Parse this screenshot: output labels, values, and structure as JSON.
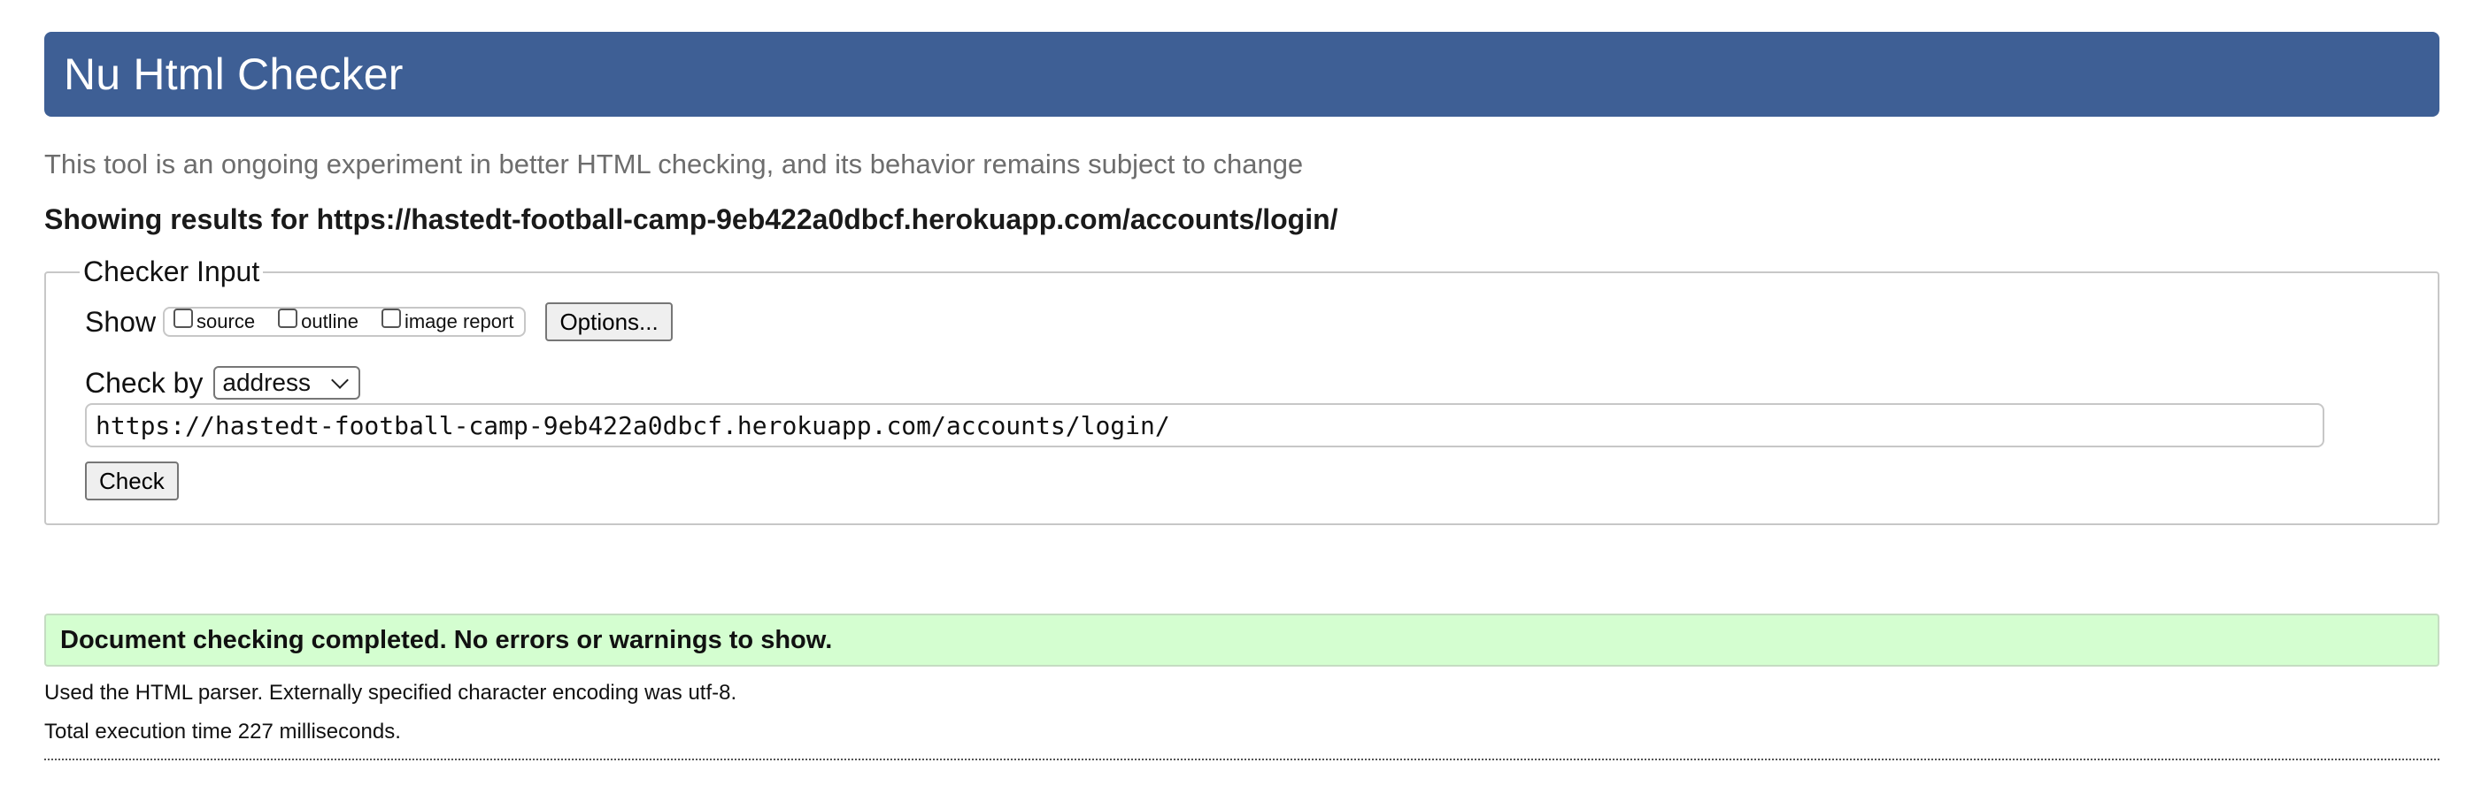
{
  "header": {
    "title": "Nu Html Checker"
  },
  "tagline": "This tool is an ongoing experiment in better HTML checking, and its behavior remains subject to change",
  "results_heading": "Showing results for https://hastedt-football-camp-9eb422a0dbcf.herokuapp.com/accounts/login/",
  "checker_input": {
    "legend": "Checker Input",
    "show_label": "Show",
    "show_options": [
      {
        "label": "source",
        "checked": false
      },
      {
        "label": "outline",
        "checked": false
      },
      {
        "label": "image report",
        "checked": false
      }
    ],
    "options_button": "Options...",
    "check_by_label": "Check by",
    "check_by_value": "address",
    "url_value": "https://hastedt-football-camp-9eb422a0dbcf.herokuapp.com/accounts/login/",
    "check_button": "Check"
  },
  "result": {
    "message": "Document checking completed. No errors or warnings to show.",
    "parser_info": "Used the HTML parser. Externally specified character encoding was utf-8.",
    "execution_time": "Total execution time 227 milliseconds."
  },
  "colors": {
    "header_bg": "#3e5f95",
    "success_bg": "#d4fed0"
  }
}
